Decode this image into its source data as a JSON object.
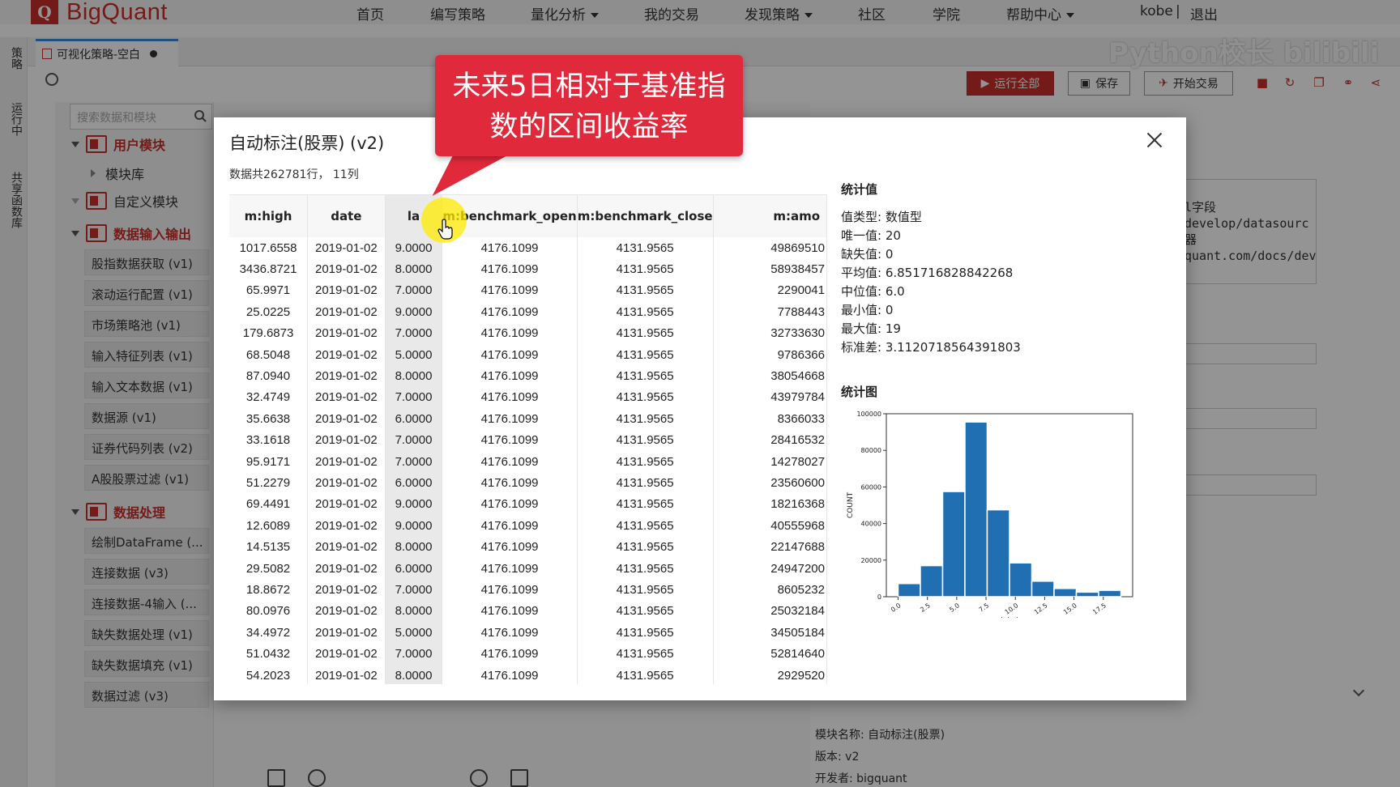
{
  "nav": {
    "logo_mark": "Q",
    "logo_text": "BigQuant",
    "items": [
      "首页",
      "编写策略",
      "量化分析",
      "我的交易",
      "发现策略",
      "社区",
      "学院",
      "帮助中心"
    ],
    "user": "kobe",
    "separator": "|",
    "logout": "退出"
  },
  "watermark": "Python校长 bilibili",
  "side_tabs": [
    "策略",
    "运行中",
    "共享函数库"
  ],
  "tab": {
    "title": "可视化策略-空白"
  },
  "toolbar": {
    "run_all": "运行全部",
    "save": "保存",
    "start_trade": "开始交易"
  },
  "left": {
    "search_placeholder": "搜索数据和模块",
    "cat_user": "用户模块",
    "leaf_lib": "模块库",
    "cat_custom": "自定义模块",
    "cat_io": "数据输入输出",
    "io_items": [
      "股指数据获取 (v1)",
      "滚动运行配置 (v1)",
      "市场策略池 (v1)",
      "输入特征列表 (v1)",
      "输入文本数据 (v1)",
      "数据源 (v1)",
      "证券代码列表 (v2)",
      "A股股票过滤 (v1)"
    ],
    "cat_proc": "数据处理",
    "proc_items": [
      "绘制DataFrame (...",
      "连接数据 (v3)",
      "连接数据-4输入 (...",
      "缺失数据处理 (v1)",
      "缺失数据填充 (v1)",
      "数据过滤 (v3)"
    ]
  },
  "right_peek": {
    "code_lines": [
      "l字段",
      "develop/datasourc",
      "器",
      "quant.com/docs/dev"
    ],
    "info": [
      "模块名称: 自动标注(股票)",
      "版本: v2",
      "开发者: bigquant"
    ]
  },
  "callout": {
    "line1": "未来5日相对于基准指",
    "line2": "数的区间收益率"
  },
  "modal": {
    "title": "自动标注(股票) (v2)",
    "summary": "数据共262781行， 11列",
    "columns": [
      "m:high",
      "date",
      "la",
      "m:benchmark_open",
      "m:benchmark_close",
      "m:amo"
    ],
    "rows": [
      [
        "1017.6558",
        "2019-01-02",
        "9.0000",
        "4176.1099",
        "4131.9565",
        "49869510"
      ],
      [
        "3436.8721",
        "2019-01-02",
        "8.0000",
        "4176.1099",
        "4131.9565",
        "58938457"
      ],
      [
        "65.9971",
        "2019-01-02",
        "7.0000",
        "4176.1099",
        "4131.9565",
        "2290041"
      ],
      [
        "25.0225",
        "2019-01-02",
        "9.0000",
        "4176.1099",
        "4131.9565",
        "7788443"
      ],
      [
        "179.6873",
        "2019-01-02",
        "7.0000",
        "4176.1099",
        "4131.9565",
        "32733630"
      ],
      [
        "68.5048",
        "2019-01-02",
        "5.0000",
        "4176.1099",
        "4131.9565",
        "9786366"
      ],
      [
        "87.0940",
        "2019-01-02",
        "8.0000",
        "4176.1099",
        "4131.9565",
        "38054668"
      ],
      [
        "32.4749",
        "2019-01-02",
        "7.0000",
        "4176.1099",
        "4131.9565",
        "43979784"
      ],
      [
        "35.6638",
        "2019-01-02",
        "6.0000",
        "4176.1099",
        "4131.9565",
        "8366033"
      ],
      [
        "33.1618",
        "2019-01-02",
        "7.0000",
        "4176.1099",
        "4131.9565",
        "28416532"
      ],
      [
        "95.9171",
        "2019-01-02",
        "7.0000",
        "4176.1099",
        "4131.9565",
        "14278027"
      ],
      [
        "51.2279",
        "2019-01-02",
        "6.0000",
        "4176.1099",
        "4131.9565",
        "23560600"
      ],
      [
        "69.4491",
        "2019-01-02",
        "9.0000",
        "4176.1099",
        "4131.9565",
        "18216368"
      ],
      [
        "12.6089",
        "2019-01-02",
        "9.0000",
        "4176.1099",
        "4131.9565",
        "40555968"
      ],
      [
        "14.5135",
        "2019-01-02",
        "8.0000",
        "4176.1099",
        "4131.9565",
        "22147688"
      ],
      [
        "29.5082",
        "2019-01-02",
        "6.0000",
        "4176.1099",
        "4131.9565",
        "24947200"
      ],
      [
        "18.8672",
        "2019-01-02",
        "7.0000",
        "4176.1099",
        "4131.9565",
        "8605232"
      ],
      [
        "80.0976",
        "2019-01-02",
        "8.0000",
        "4176.1099",
        "4131.9565",
        "25032184"
      ],
      [
        "34.4972",
        "2019-01-02",
        "5.0000",
        "4176.1099",
        "4131.9565",
        "34505184"
      ],
      [
        "51.0432",
        "2019-01-02",
        "7.0000",
        "4176.1099",
        "4131.9565",
        "52814640"
      ],
      [
        "54.2023",
        "2019-01-02",
        "8.0000",
        "4176.1099",
        "4131.9565",
        "2929520"
      ]
    ],
    "stats_title": "统计值",
    "stats": [
      "值类型: 数值型",
      "唯一值: 20",
      "缺失值: 0",
      "平均值: 6.851716828842268",
      "中位值: 6.0",
      "最小值: 0",
      "最大值: 19",
      "标准差: 3.1120718564391803"
    ],
    "chart_title": "统计图"
  },
  "chart_data": {
    "type": "bar",
    "xlabel": "label",
    "ylabel": "COUNT",
    "x_edges": [
      0,
      1.9,
      3.8,
      5.7,
      7.6,
      9.5,
      11.4,
      13.3,
      15.2,
      17.1,
      19.0
    ],
    "values": [
      7200,
      17000,
      57500,
      95500,
      47500,
      18500,
      8500,
      4500,
      2500,
      3500
    ],
    "xticks": [
      0.0,
      2.5,
      5.0,
      7.5,
      10.0,
      12.5,
      15.0,
      17.5
    ],
    "xtick_labels": [
      "0.0",
      "2.5",
      "5.0",
      "7.5",
      "10.0",
      "12.5",
      "15.0",
      "17.5"
    ],
    "yticks": [
      0,
      20000,
      40000,
      60000,
      80000,
      100000
    ],
    "ytick_labels": [
      "0",
      "20000",
      "40000",
      "60000",
      "80000",
      "100000"
    ],
    "xlim": [
      -1.0,
      20.0
    ],
    "ylim": [
      0,
      100000
    ],
    "bar_color": "#1f6fb2",
    "grid": false
  },
  "colors": {
    "brand": "#c9302c",
    "callout": "#e0293b",
    "tab_accent": "#3b8ad8"
  }
}
